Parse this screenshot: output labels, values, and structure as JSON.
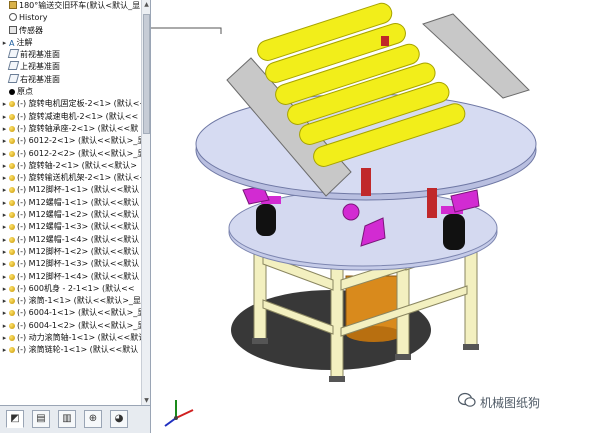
{
  "tree": {
    "items": [
      {
        "label": "180°输送交旧环车(默认<默认_显",
        "icon": "asm",
        "exp": ""
      },
      {
        "label": "History",
        "icon": "hist",
        "exp": ""
      },
      {
        "label": "传感器",
        "icon": "sensor",
        "exp": ""
      },
      {
        "label": "注解",
        "icon": "note",
        "exp": "▸"
      },
      {
        "label": "前视基准面",
        "icon": "plane",
        "exp": ""
      },
      {
        "label": "上视基准面",
        "icon": "plane",
        "exp": ""
      },
      {
        "label": "右视基准面",
        "icon": "plane",
        "exp": ""
      },
      {
        "label": "原点",
        "icon": "origin",
        "exp": ""
      },
      {
        "label": "(-) 旋转电机固定板-2<1> (默认<<",
        "icon": "part",
        "exp": "▸"
      },
      {
        "label": "(-) 旋转减速电机-2<1> (默认<<",
        "icon": "part",
        "exp": "▸"
      },
      {
        "label": "(-) 旋转轴承座-2<1> (默认<<默",
        "icon": "part",
        "exp": "▸"
      },
      {
        "label": "(-) 6012-2<1> (默认<<默认>_显",
        "icon": "part",
        "exp": "▸"
      },
      {
        "label": "(-) 6012-2<2> (默认<<默认>_显",
        "icon": "part",
        "exp": "▸"
      },
      {
        "label": "(-) 旋转轴-2<1> (默认<<默认>",
        "icon": "part",
        "exp": "▸"
      },
      {
        "label": "(-) 旋转输送机机架-2<1> (默认<<",
        "icon": "part",
        "exp": "▸"
      },
      {
        "label": "(-) M12脚杯-1<1> (默认<<默认",
        "icon": "part",
        "exp": "▸"
      },
      {
        "label": "(-) M12螺帽-1<1> (默认<<默认",
        "icon": "part",
        "exp": "▸"
      },
      {
        "label": "(-) M12螺帽-1<2> (默认<<默认",
        "icon": "part",
        "exp": "▸"
      },
      {
        "label": "(-) M12螺帽-1<3> (默认<<默认",
        "icon": "part",
        "exp": "▸"
      },
      {
        "label": "(-) M12螺帽-1<4> (默认<<默认",
        "icon": "part",
        "exp": "▸"
      },
      {
        "label": "(-) M12脚杯-1<2> (默认<<默认",
        "icon": "part",
        "exp": "▸"
      },
      {
        "label": "(-) M12脚杯-1<3> (默认<<默认",
        "icon": "part",
        "exp": "▸"
      },
      {
        "label": "(-) M12脚杯-1<4> (默认<<默认",
        "icon": "part",
        "exp": "▸"
      },
      {
        "label": "(-) 600机身 - 2-1<1> (默认<<",
        "icon": "part",
        "exp": "▸"
      },
      {
        "label": "(-) 滚筒-1<1> (默认<<默认>_显",
        "icon": "part",
        "exp": "▸"
      },
      {
        "label": "(-) 6004-1<1> (默认<<默认>_显",
        "icon": "part",
        "exp": "▸"
      },
      {
        "label": "(-) 6004-1<2> (默认<<默认>_显",
        "icon": "part",
        "exp": "▸"
      },
      {
        "label": "(-) 动力滚筒轴-1<1> (默认<<默认",
        "icon": "part",
        "exp": "▸"
      },
      {
        "label": "(-) 滚筒链轮-1<1> (默认<<默认",
        "icon": "part",
        "exp": "▸"
      }
    ]
  },
  "bottom_tabs": [
    {
      "name": "feature-manager-tab",
      "glyph": "◩"
    },
    {
      "name": "property-manager-tab",
      "glyph": "▤"
    },
    {
      "name": "configuration-manager-tab",
      "glyph": "▥"
    },
    {
      "name": "dimxpert-tab",
      "glyph": "⊕"
    },
    {
      "name": "display-manager-tab",
      "glyph": "◕"
    }
  ],
  "watermark": {
    "text": "机械图纸狗"
  },
  "colors": {
    "roller_yellow": "#f2ee1a",
    "plate_blue": "#c5cbe8",
    "frame_cream": "#f3f0c0",
    "bracket_magenta": "#d22bd2",
    "guide_gray": "#c8c8c8",
    "motor_orange": "#d98a1c",
    "end_red": "#c0282a"
  }
}
